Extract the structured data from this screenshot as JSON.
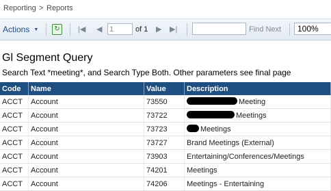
{
  "breadcrumb": {
    "items": [
      "Reporting",
      ">",
      "Reports"
    ]
  },
  "toolbar": {
    "actions_label": "Actions",
    "page_current": "1",
    "page_of_label": "of 1",
    "find_placeholder": "",
    "find_next_label": "Find Next",
    "zoom": "100%"
  },
  "report": {
    "title": "Gl Segment Query",
    "subtitle": "Search Text *meeting*, and Search Type Both. Other parameters see final page",
    "columns": [
      "Code",
      "Name",
      "Value",
      "Description"
    ],
    "rows": [
      {
        "code": "ACCT",
        "name": "Account",
        "value": "73550",
        "description": "Meeting",
        "redacted": true
      },
      {
        "code": "ACCT",
        "name": "Account",
        "value": "73722",
        "description": "Meetings",
        "redacted": true
      },
      {
        "code": "ACCT",
        "name": "Account",
        "value": "73723",
        "description": "Meetings",
        "redacted": true
      },
      {
        "code": "ACCT",
        "name": "Account",
        "value": "73727",
        "description": "Brand Meetings (External)",
        "redacted": false
      },
      {
        "code": "ACCT",
        "name": "Account",
        "value": "73903",
        "description": "Entertaining/Conferences/Meetings",
        "redacted": false
      },
      {
        "code": "ACCT",
        "name": "Account",
        "value": "74201",
        "description": "Meetings",
        "redacted": false
      },
      {
        "code": "ACCT",
        "name": "Account",
        "value": "74206",
        "description": "Meetings - Entertaining",
        "redacted": false
      }
    ]
  },
  "colors": {
    "header_bg": "#1f4e80",
    "link": "#1f4c8a"
  }
}
